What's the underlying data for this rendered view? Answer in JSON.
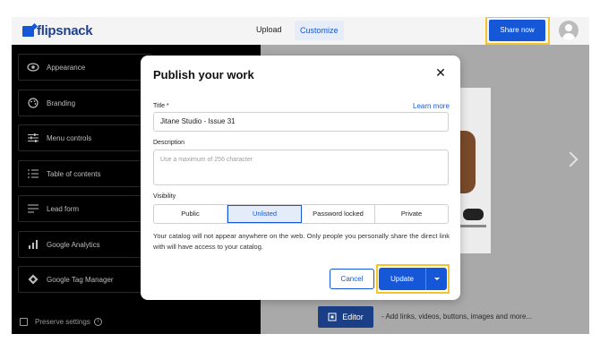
{
  "app": {
    "logo_text": "flipsnack",
    "tabs": {
      "upload": "Upload",
      "customize": "Customize"
    },
    "share_label": "Share now",
    "colors": {
      "accent": "#1557d6",
      "highlight": "#f2c62a"
    }
  },
  "sidebar": {
    "items": [
      {
        "label": "Appearance",
        "icon": "eye-icon"
      },
      {
        "label": "Branding",
        "icon": "palette-icon"
      },
      {
        "label": "Menu controls",
        "icon": "sliders-icon"
      },
      {
        "label": "Table of contents",
        "icon": "list-icon"
      },
      {
        "label": "Lead form",
        "icon": "form-icon"
      },
      {
        "label": "Google Analytics",
        "icon": "bar-chart-icon"
      },
      {
        "label": "Google Tag Manager",
        "icon": "diamond-icon"
      }
    ],
    "preserve_label": "Preserve settings"
  },
  "editor": {
    "label": "Editor",
    "hint": "- Add links, videos, buttons, images and more..."
  },
  "modal": {
    "title": "Publish your work",
    "title_label": "Title *",
    "learn_more": "Learn more",
    "title_value": "Jitane Studio - Issue 31",
    "description_label": "Description",
    "description_placeholder": "Use a maximum of 256 character",
    "visibility_label": "Visibility",
    "visibility_options": [
      "Public",
      "Unlisted",
      "Password locked",
      "Private"
    ],
    "visibility_selected": "Unlisted",
    "note": "Your catalog will not appear anywhere on the web. Only people you personally share the direct link with will have access to your catalog.",
    "cancel_label": "Cancel",
    "update_label": "Update"
  }
}
